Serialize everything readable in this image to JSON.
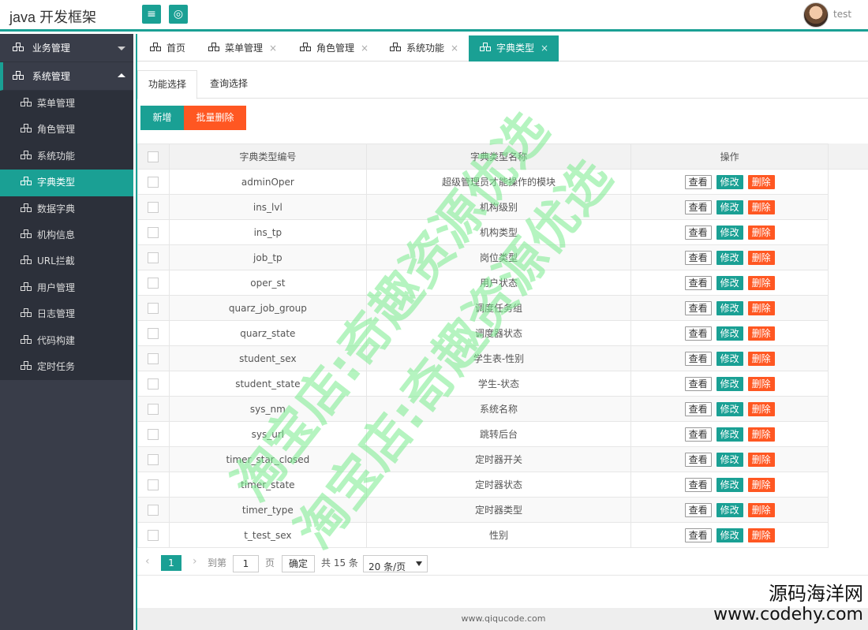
{
  "header": {
    "brand": "java 开发框架",
    "menu_icon": "menu-icon",
    "globe_icon": "globe-icon",
    "username": "test"
  },
  "sidebar": {
    "groups": [
      {
        "label": "业务管理",
        "expanded": false
      },
      {
        "label": "系统管理",
        "expanded": true
      }
    ],
    "items": [
      {
        "label": "菜单管理"
      },
      {
        "label": "角色管理"
      },
      {
        "label": "系统功能"
      },
      {
        "label": "字典类型",
        "active": true
      },
      {
        "label": "数据字典"
      },
      {
        "label": "机构信息"
      },
      {
        "label": "URL拦截"
      },
      {
        "label": "用户管理"
      },
      {
        "label": "日志管理"
      },
      {
        "label": "代码构建"
      },
      {
        "label": "定时任务"
      }
    ]
  },
  "tabs": [
    {
      "label": "首页",
      "closable": false
    },
    {
      "label": "菜单管理",
      "close": "×"
    },
    {
      "label": "角色管理",
      "close": "×"
    },
    {
      "label": "系统功能",
      "close": "×"
    },
    {
      "label": "字典类型",
      "close": "×",
      "active": true
    }
  ],
  "subtabs": [
    {
      "label": "功能选择",
      "active": true
    },
    {
      "label": "查询选择"
    }
  ],
  "toolbar": {
    "add_label": "新增",
    "batch_delete_label": "批量删除"
  },
  "table": {
    "columns": [
      "字典类型编号",
      "字典类型名称",
      "操作"
    ],
    "actions": {
      "view": "查看",
      "edit": "修改",
      "delete": "删除"
    },
    "rows": [
      {
        "code": "adminOper",
        "name": "超级管理员才能操作的模块"
      },
      {
        "code": "ins_lvl",
        "name": "机构级别"
      },
      {
        "code": "ins_tp",
        "name": "机构类型"
      },
      {
        "code": "job_tp",
        "name": "岗位类型"
      },
      {
        "code": "oper_st",
        "name": "用户状态"
      },
      {
        "code": "quarz_job_group",
        "name": "调度任务组"
      },
      {
        "code": "quarz_state",
        "name": "调度器状态"
      },
      {
        "code": "student_sex",
        "name": "学生表-性别"
      },
      {
        "code": "student_state",
        "name": "学生-状态"
      },
      {
        "code": "sys_nm",
        "name": "系统名称"
      },
      {
        "code": "sys_url",
        "name": "跳转后台"
      },
      {
        "code": "timer_star_closed",
        "name": "定时器开关"
      },
      {
        "code": "timer_state",
        "name": "定时器状态"
      },
      {
        "code": "timer_type",
        "name": "定时器类型"
      },
      {
        "code": "t_test_sex",
        "name": "性别"
      }
    ]
  },
  "pager": {
    "prev": "‹",
    "current": "1",
    "next": "›",
    "goto": "到第",
    "input_value": "1",
    "page_unit": "页",
    "confirm": "确定",
    "total": "共 15 条",
    "page_size": "20 条/页"
  },
  "footer": {
    "text": "www.qiqucode.com"
  },
  "watermarks": {
    "line": "淘宝店:奇趣资源优选",
    "corner_a": "源码海洋网",
    "corner_b": "www.codehy.com"
  },
  "colors": {
    "accent": "#1aa094",
    "danger": "#ff5722",
    "sidebar": "#393d49"
  }
}
